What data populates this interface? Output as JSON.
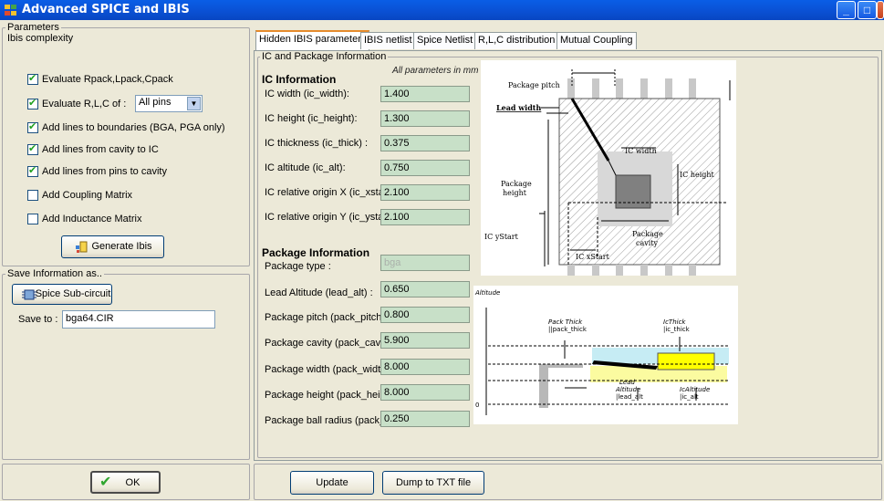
{
  "window": {
    "title": "Advanced SPICE and IBIS",
    "controls": [
      "_",
      "□",
      "×"
    ]
  },
  "left": {
    "params_legend": "Parameters",
    "ibis_legend": "Ibis complexity",
    "checkboxes": [
      {
        "label": "Evaluate Rpack,Lpack,Cpack",
        "checked": true
      },
      {
        "label": "Evaluate R,L,C of :",
        "checked": true
      },
      {
        "label": "Add lines to boundaries (BGA, PGA only)",
        "checked": true
      },
      {
        "label": "Add lines from cavity to IC",
        "checked": true
      },
      {
        "label": "Add lines from pins to cavity",
        "checked": true
      },
      {
        "label": "Add Coupling Matrix",
        "checked": false
      },
      {
        "label": "Add Inductance Matrix",
        "checked": false
      }
    ],
    "rlc_select": "All pins",
    "generate_label": "Generate Ibis",
    "save_legend": "Save Information as..",
    "spice_label": "Spice Sub-circuit",
    "save_to_label": "Save to :",
    "save_to_value": "bga64.CIR",
    "ok_label": "OK"
  },
  "tabs": [
    "Hidden IBIS parameters",
    "IBIS netlist",
    "Spice Netlist",
    "R,L,C distribution",
    "Mutual Coupling"
  ],
  "active_tab": 0,
  "content": {
    "group_legend": "IC and Package Information",
    "ic_title": "IC Information",
    "units_note": "All parameters in mm",
    "ic_params": [
      {
        "label": "IC width (ic_width):",
        "value": "1.400"
      },
      {
        "label": "IC height (ic_height):",
        "value": "1.300"
      },
      {
        "label": "IC thickness (ic_thick) :",
        "value": "0.375"
      },
      {
        "label": "IC altitude (ic_alt):",
        "value": "0.750"
      },
      {
        "label": "IC relative origin X (ic_xstart) :",
        "value": "2.100"
      },
      {
        "label": "IC relative origin Y (ic_ystart):",
        "value": "2.100"
      }
    ],
    "pkg_title": "Package Information",
    "pkg_params": [
      {
        "label": "Package type :",
        "value": "bga"
      },
      {
        "label": "Lead Altitude (lead_alt) :",
        "value": "0.650"
      },
      {
        "label": "Package pitch (pack_pitch):",
        "value": "0.800"
      },
      {
        "label": "Package cavity (pack_cavity):",
        "value": "5.900"
      },
      {
        "label": "Package width (pack_width) :",
        "value": "8.000"
      },
      {
        "label": "Package height (pack_height):",
        "value": "8.000"
      },
      {
        "label": "Package ball radius (pack_ball) :",
        "value": "0.250"
      }
    ],
    "top_diagram": {
      "package_pitch": "Package pitch",
      "lead_width": "Lead width",
      "ic_width": "IC width",
      "ic_height": "IC height",
      "package_height_1": "Package",
      "package_height_2": "height",
      "package_cavity_1": "Package",
      "package_cavity_2": "cavity",
      "ic_ystart": "IC yStart",
      "ic_xstart": "IC xStart"
    },
    "side_diagram": {
      "altitude": "Altitude",
      "pack_thick_1": "Pack Thick",
      "pack_thick_2": "||pack_thick",
      "ic_thick_1": "IcThick",
      "ic_thick_2": "|ic_thick",
      "lead_1": "Lead",
      "lead_2": "Altitude",
      "lead_3": "|lead_alt",
      "ic_alt_1": "IcAltitude",
      "ic_alt_2": "|ic_alt",
      "zero": "0"
    }
  },
  "footer": {
    "update_label": "Update",
    "dump_label": "Dump to TXT file"
  }
}
